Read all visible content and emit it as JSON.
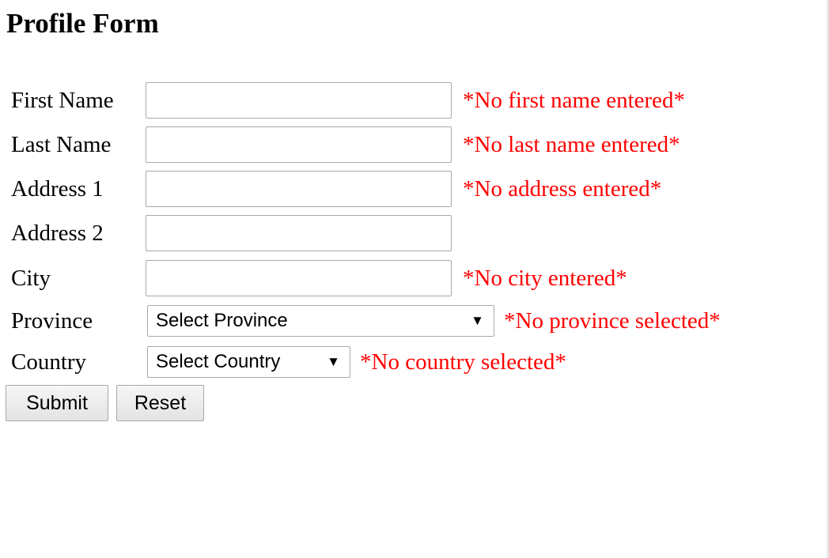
{
  "form": {
    "title": "Profile Form",
    "fields": {
      "first_name": {
        "label": "First Name",
        "value": "",
        "error": "*No first name entered*"
      },
      "last_name": {
        "label": "Last Name",
        "value": "",
        "error": "*No last name entered*"
      },
      "address1": {
        "label": "Address 1",
        "value": "",
        "error": "*No address entered*"
      },
      "address2": {
        "label": "Address 2",
        "value": ""
      },
      "city": {
        "label": "City",
        "value": "",
        "error": "*No city entered*"
      },
      "province": {
        "label": "Province",
        "selected": "Select Province",
        "error": "*No province selected*"
      },
      "country": {
        "label": "Country",
        "selected": "Select Country",
        "error": "*No country selected*"
      }
    },
    "buttons": {
      "submit_label": "Submit",
      "reset_label": "Reset"
    }
  },
  "icons": {
    "dropdown": "chevron-down-icon"
  },
  "colors": {
    "error": "#ff0000",
    "input_border": "#a9a9a9",
    "button_bg": "#efefef"
  }
}
